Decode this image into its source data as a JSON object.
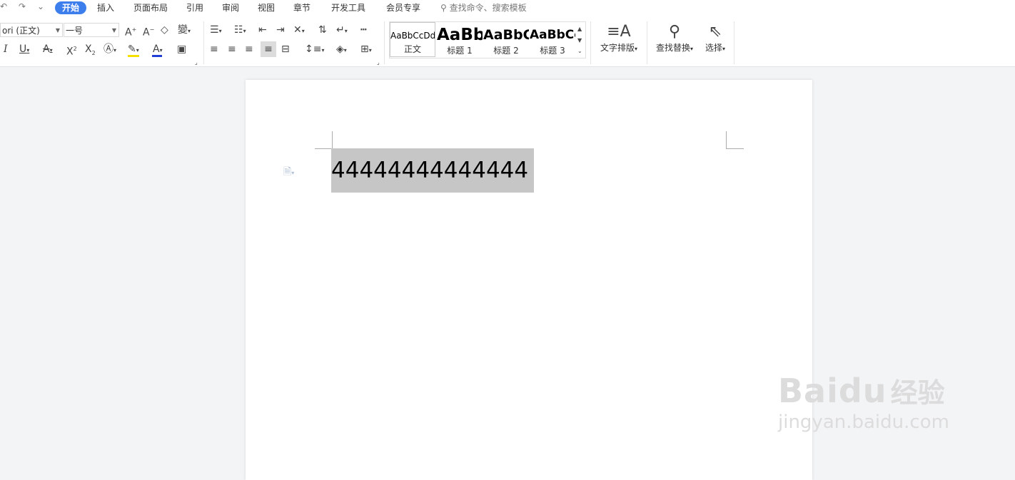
{
  "quick_access": {
    "undo": "↶",
    "redo": "↷",
    "more": "⌄"
  },
  "tabs": [
    {
      "label": "开始",
      "active": true
    },
    {
      "label": "插入"
    },
    {
      "label": "页面布局"
    },
    {
      "label": "引用"
    },
    {
      "label": "审阅"
    },
    {
      "label": "视图"
    },
    {
      "label": "章节"
    },
    {
      "label": "开发工具"
    },
    {
      "label": "会员专享"
    }
  ],
  "search": {
    "placeholder": "查找命令、搜索模板"
  },
  "font": {
    "name": "ori (正文)",
    "size": "一号"
  },
  "styles": [
    {
      "sample": "AaBbCcDd",
      "name": "正文"
    },
    {
      "sample": "AaBb",
      "name": "标题 1"
    },
    {
      "sample": "AaBbC",
      "name": "标题 2"
    },
    {
      "sample": "AaBbCc",
      "name": "标题 3"
    }
  ],
  "big_buttons": {
    "text_layout": "文字排版",
    "find_replace": "查找替换",
    "select": "选择"
  },
  "document": {
    "text": "44444444444444"
  },
  "watermark": {
    "brand": "Baidu",
    "service": "经验",
    "url": "jingyan.baidu.com"
  },
  "colors": {
    "accent": "#3d7eed",
    "highlight_bar": "#f5e000",
    "font_color_bar": "#1f3fd6",
    "selection": "#c6c6c6"
  }
}
